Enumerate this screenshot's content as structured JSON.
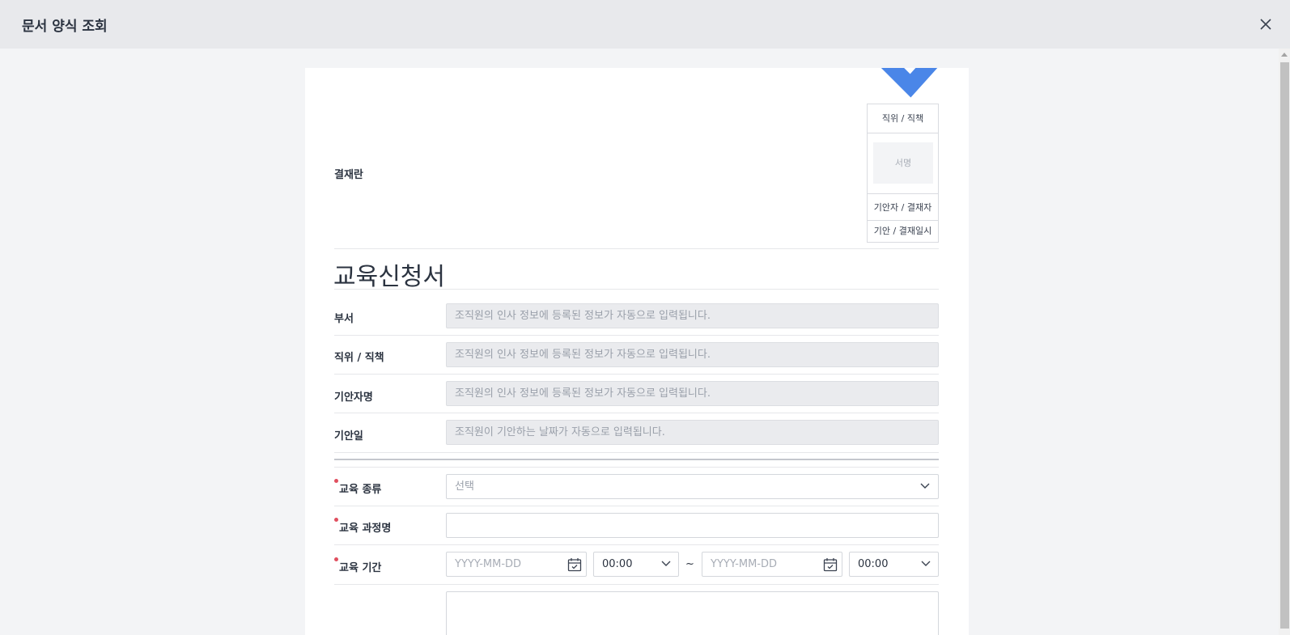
{
  "modal": {
    "title": "문서 양식 조회"
  },
  "approval": {
    "label": "결재란",
    "position_header": "직위 / 직책",
    "sign_placeholder": "서명",
    "drafter_row": "기안자 / 결재자",
    "date_row": "기안 / 결재일시"
  },
  "document": {
    "title": "교육신청서"
  },
  "readonly_fields": [
    {
      "label": "부서",
      "value": "조직원의 인사 정보에 등록된 정보가 자동으로 입력됩니다."
    },
    {
      "label": "직위 / 직책",
      "value": "조직원의 인사 정보에 등록된 정보가 자동으로 입력됩니다."
    },
    {
      "label": "기안자명",
      "value": "조직원의 인사 정보에 등록된 정보가 자동으로 입력됩니다."
    },
    {
      "label": "기안일",
      "value": "조직원이 기안하는 날짜가 자동으로 입력됩니다."
    }
  ],
  "form": {
    "type": {
      "label": "교육 종류",
      "required": true,
      "placeholder": "선택"
    },
    "course": {
      "label": "교육 과정명",
      "required": true,
      "value": ""
    },
    "period": {
      "label": "교육 기간",
      "required": true,
      "start_date_placeholder": "YYYY-MM-DD",
      "start_time": "00:00",
      "separator": "~",
      "end_date_placeholder": "YYYY-MM-DD",
      "end_time": "00:00"
    }
  },
  "icons": {
    "close": "close-icon",
    "checkmark": "checkmark-icon",
    "chevron": "chevron-down-icon",
    "calendar": "calendar-icon"
  },
  "colors": {
    "checkmark": "#4a86e8",
    "required_dot": "#e04f5f",
    "header_bg": "#e8e9ec",
    "readonly_bg": "#eaebee"
  }
}
